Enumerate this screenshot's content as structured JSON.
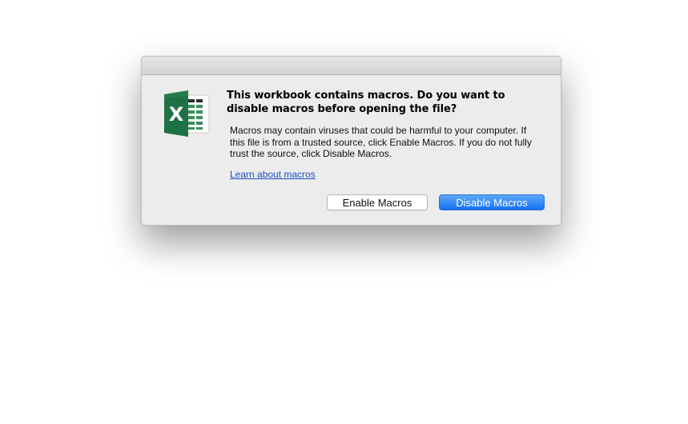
{
  "dialog": {
    "headline": "This workbook contains macros. Do you want to disable macros before opening the file?",
    "message": "Macros may contain viruses that could be harmful to your computer.  If this file is from a trusted source, click Enable Macros. If you do not fully trust the source, click Disable Macros.",
    "link_label": "Learn about macros",
    "enable_button": "Enable Macros",
    "disable_button": "Disable Macros",
    "app_icon": "excel-icon",
    "app_icon_letter": "X"
  },
  "colors": {
    "excel_green": "#1e7145",
    "primary_button": "#1570f2",
    "link": "#1a4fc4"
  }
}
